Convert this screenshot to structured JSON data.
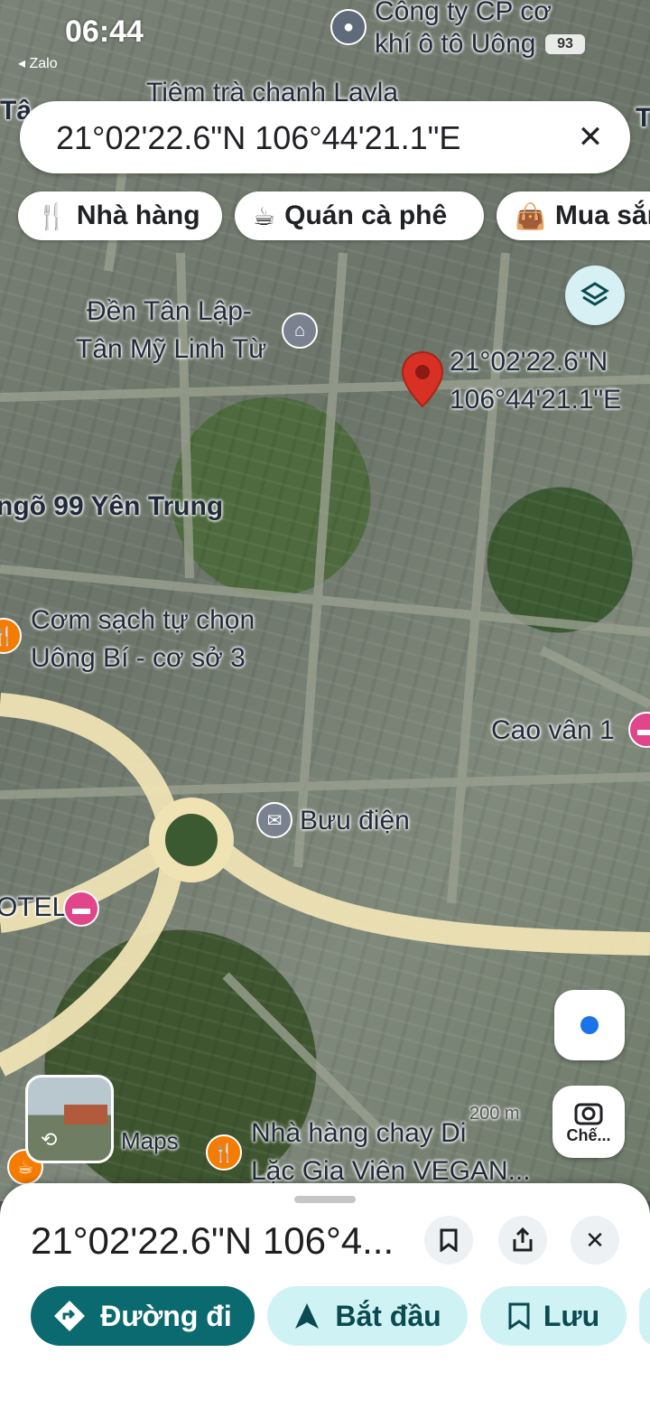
{
  "status_bar": {
    "time": "06:44",
    "back_app": "◂ Zalo",
    "battery": "93"
  },
  "search": {
    "query": "21°02'22.6\"N 106°44'21.1\"E"
  },
  "chips": [
    {
      "icon": "restaurant-icon",
      "label": "Nhà hàng"
    },
    {
      "icon": "coffee-icon",
      "label": "Quán cà phê"
    },
    {
      "icon": "shopping-bag-icon",
      "label": "Mua sắm"
    }
  ],
  "map_labels": {
    "top_poi_line1": "Công ty CP cơ",
    "top_poi_line2": "khí ô tô Uông",
    "tiem_tra": "Tiệm trà chanh Layla",
    "den_line1": "Đền Tân Lập-",
    "den_line2": "Tân Mỹ Linh Từ",
    "pin_lat": "21°02'22.6\"N",
    "pin_lng": "106°44'21.1\"E",
    "ngo": "ngõ 99 Yên Trung",
    "com_line1": "Cơm sạch tự chọn",
    "com_line2": "Uông Bí - cơ sở 3",
    "cao_van": "Cao vân 1",
    "buu_dien": "Bưu điện",
    "hotel": "OTEL",
    "nha_hang_line1": "Nhà hàng chay Di",
    "nha_hang_line2": "Lặc Gia Viên VEGAN...",
    "maps_watermark": "Maps",
    "scale": "200 m",
    "left_edge": "Tâ",
    "right_edge": "T"
  },
  "lens_button": {
    "label": "Chế..."
  },
  "sheet": {
    "title": "21°02'22.6\"N 106°4...",
    "actions": [
      {
        "label": "Đường đi",
        "icon": "directions-icon",
        "bg": "#0b6970",
        "fg": "#ffffff"
      },
      {
        "label": "Bắt đầu",
        "icon": "navigation-arrow-icon",
        "bg": "#cff3f4",
        "fg": "#0b4a50"
      },
      {
        "label": "Lưu",
        "icon": "bookmark-icon",
        "bg": "#cff3f4",
        "fg": "#0b4a50"
      }
    ]
  },
  "colors": {
    "pin": "#d93025",
    "road": "#efe3b4",
    "location_dot": "#1a73e8"
  }
}
